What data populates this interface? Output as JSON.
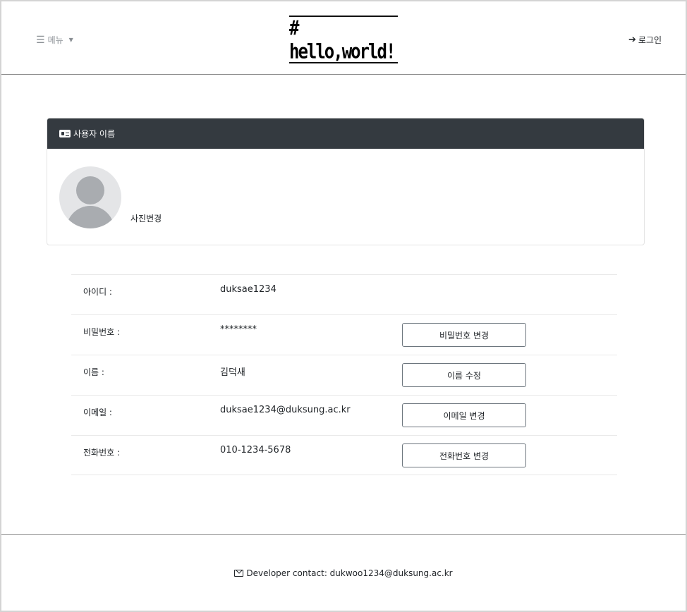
{
  "header": {
    "menu_label": "메뉴",
    "logo_text": "# hello,world!",
    "login_label": "로그인"
  },
  "profile": {
    "card_title": "사용자 이름",
    "photo_change_label": "사진변경"
  },
  "info_rows": [
    {
      "label": "아이디 :",
      "value": "duksae1234"
    },
    {
      "label": "비밀번호 :",
      "value": "********",
      "button": "비밀번호 변경"
    },
    {
      "label": "이름 :",
      "value": "김덕새",
      "button": "이름 수정"
    },
    {
      "label": "이메일 :",
      "value": "duksae1234@duksung.ac.kr",
      "button": "이메일 변경"
    },
    {
      "label": "전화번호 :",
      "value": "010-1234-5678",
      "button": "전화번호 변경"
    }
  ],
  "footer": {
    "contact_text": "Developer contact: dukwoo1234@duksung.ac.kr"
  },
  "icons": {
    "menu": "hamburger-icon",
    "menu_caret": "caret-down-icon",
    "login": "sign-in-icon",
    "card": "id-card-icon",
    "avatar": "user-placeholder-icon",
    "footer": "envelope-icon"
  },
  "colors": {
    "card_header_bg": "#343a40",
    "menu_text": "#8a8f94",
    "button_border": "#6c757d"
  }
}
